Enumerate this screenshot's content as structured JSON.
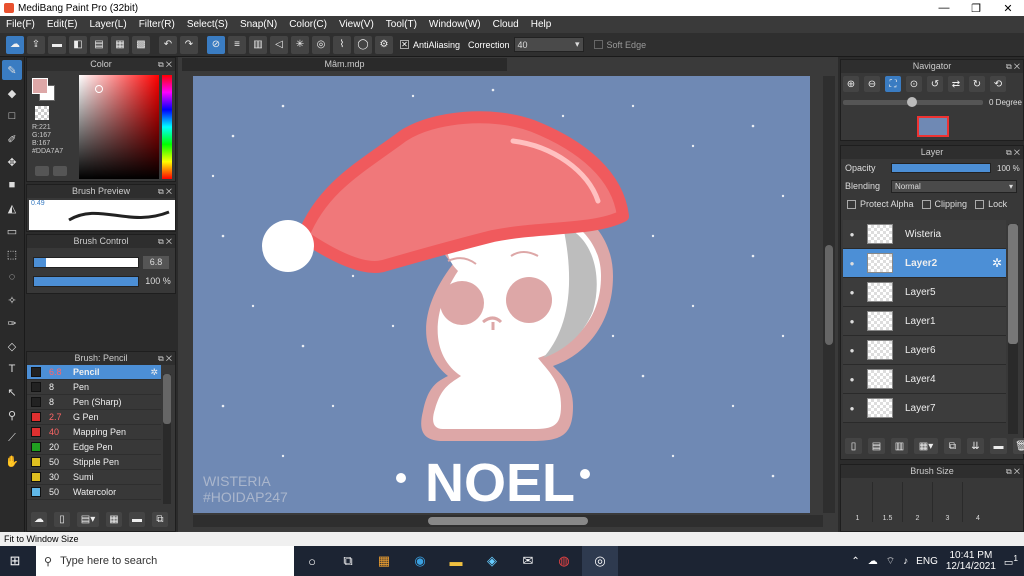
{
  "window": {
    "title": "MediBang Paint Pro (32bit)",
    "min": "—",
    "max": "❐",
    "close": "✕"
  },
  "menu": [
    "File(F)",
    "Edit(E)",
    "Layer(L)",
    "Filter(R)",
    "Select(S)",
    "Snap(N)",
    "Color(C)",
    "View(V)",
    "Tool(T)",
    "Window(W)",
    "Cloud",
    "Help"
  ],
  "toolbar": {
    "antialias_label": "AntiAliasing",
    "correction_label": "Correction",
    "correction_value": "40",
    "soft_edge_label": "Soft Edge",
    "check_mark": "✕"
  },
  "color_panel": {
    "title": "Color",
    "r": "R:221",
    "g": "G:167",
    "b": "B:167",
    "hex": "#DDA7A7",
    "primary_color": "#dda7a7"
  },
  "brush_preview": {
    "title": "Brush Preview",
    "size_text": "0.49"
  },
  "brush_control": {
    "title": "Brush Control",
    "size_value": "6.8",
    "opacity_value": "100 %"
  },
  "brush_list": {
    "title": "Brush: Pencil",
    "items": [
      {
        "size": "6.8",
        "name": "Pencil",
        "color": "#222222"
      },
      {
        "size": "8",
        "name": "Pen",
        "color": "#222222"
      },
      {
        "size": "8",
        "name": "Pen (Sharp)",
        "color": "#222222"
      },
      {
        "size": "2.7",
        "name": "G Pen",
        "color": "#e03030"
      },
      {
        "size": "40",
        "name": "Mapping Pen",
        "color": "#e03030"
      },
      {
        "size": "20",
        "name": "Edge Pen",
        "color": "#20a020"
      },
      {
        "size": "50",
        "name": "Stipple Pen",
        "color": "#e0c020"
      },
      {
        "size": "30",
        "name": "Sumi",
        "color": "#e0c020"
      },
      {
        "size": "50",
        "name": "Watercolor",
        "color": "#60b8e8"
      }
    ]
  },
  "document": {
    "tab": "Mâm.mdp",
    "watermark_1": "WISTERIA",
    "watermark_2": "#HOIDAP247",
    "text": "NOEL"
  },
  "navigator": {
    "title": "Navigator",
    "angle": "0 Degree"
  },
  "layer_panel": {
    "title": "Layer",
    "opacity_label": "Opacity",
    "opacity_value": "100 %",
    "blending_label": "Blending",
    "blending_value": "Normal",
    "protect_alpha": "Protect Alpha",
    "clipping": "Clipping",
    "lock": "Lock",
    "layers": [
      "Wisteria",
      "Layer2",
      "Layer5",
      "Layer1",
      "Layer6",
      "Layer4",
      "Layer7"
    ],
    "selected": "Layer2"
  },
  "brush_size": {
    "title": "Brush Size",
    "labels": [
      "1",
      "1.5",
      "2",
      "3",
      "4"
    ]
  },
  "status": "Fit to Window Size",
  "taskbar": {
    "search_placeholder": "Type here to search",
    "lang": "ENG",
    "time": "10:41 PM",
    "date": "12/14/2021",
    "notif": "1"
  }
}
